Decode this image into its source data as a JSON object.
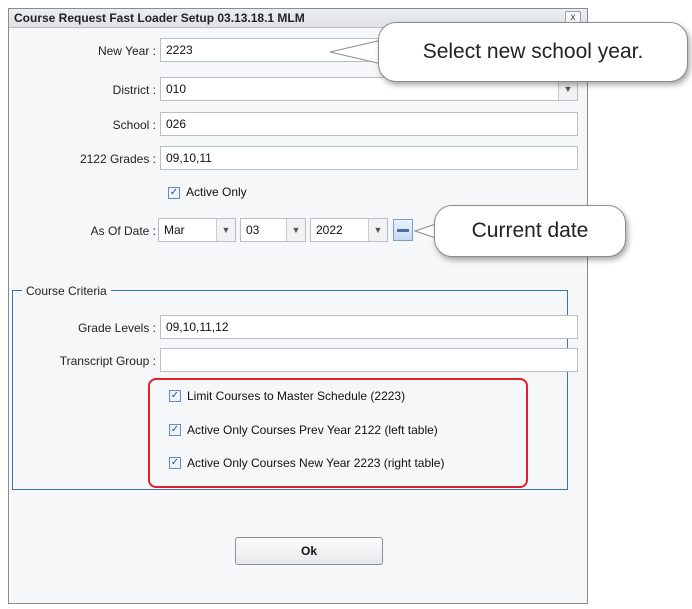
{
  "dialog": {
    "title": "Course Request Fast Loader Setup 03.13.18.1 MLM",
    "close_label": "x"
  },
  "form": {
    "new_year_label": "New Year :",
    "new_year_value": "2223",
    "district_label": "District :",
    "district_value": "010",
    "school_label": "School :",
    "school_value": "026",
    "grades_label": "2122 Grades :",
    "grades_value": "09,10,11",
    "active_only_label": "Active Only",
    "active_only_checked": true,
    "as_of_date_label": "As Of Date :",
    "month_value": "Mar",
    "day_value": "03",
    "year_value": "2022"
  },
  "criteria": {
    "legend": "Course Criteria",
    "grade_levels_label": "Grade Levels :",
    "grade_levels_value": "09,10,11,12",
    "transcript_group_label": "Transcript Group :",
    "transcript_group_value": "",
    "options": [
      {
        "label": "Limit Courses to Master Schedule (2223)",
        "checked": true
      },
      {
        "label": "Active Only Courses Prev Year 2122 (left table)",
        "checked": true
      },
      {
        "label": "Active Only Courses New Year 2223 (right table)",
        "checked": true
      }
    ]
  },
  "ok_label": "Ok",
  "callouts": {
    "school_year": "Select new school year.",
    "current_date": "Current date"
  },
  "colors": {
    "highlight_border": "#e0202a",
    "fieldset_border": "#3b73b9",
    "checkbox_accent": "#2b4f86"
  }
}
